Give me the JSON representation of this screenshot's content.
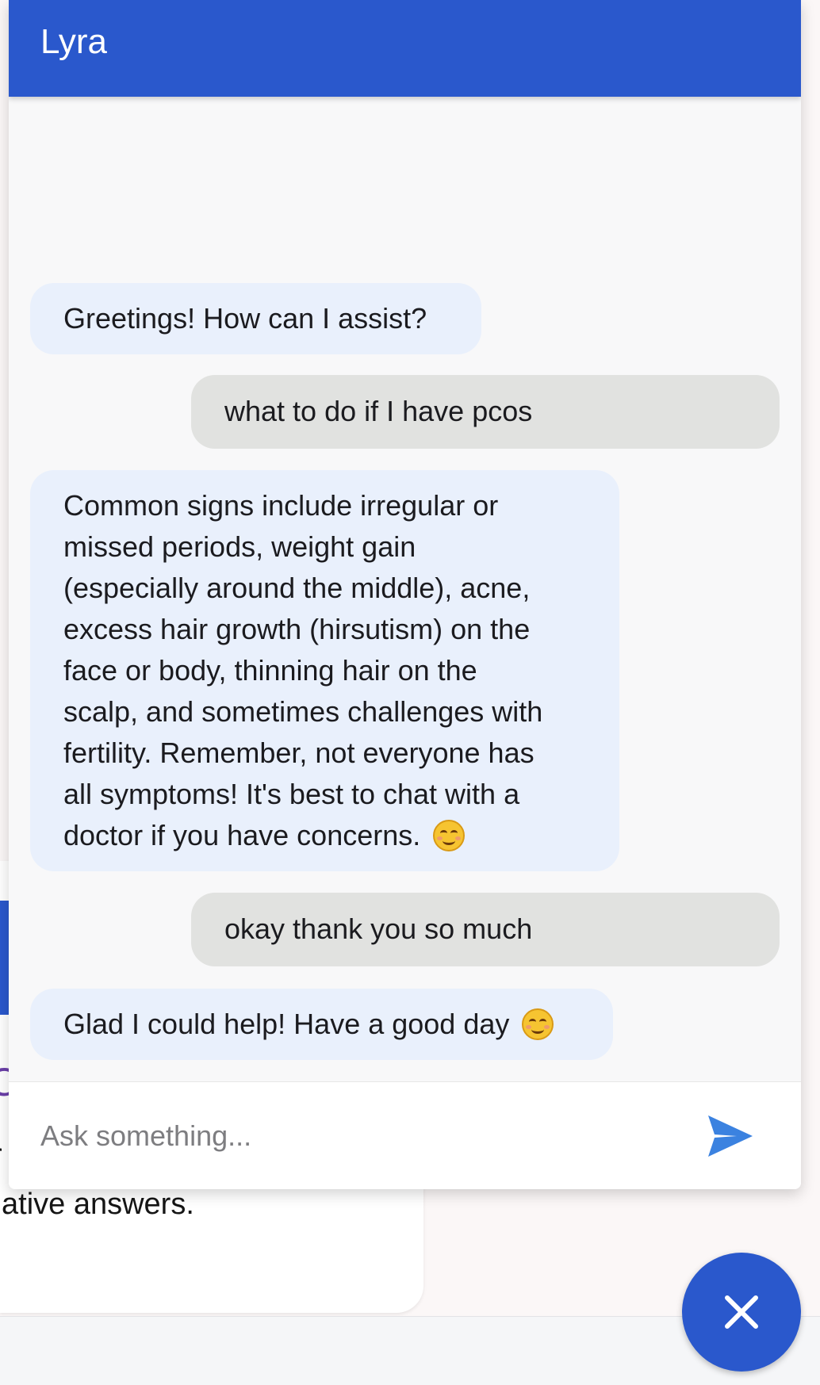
{
  "header": {
    "title": "Lyra"
  },
  "messages": [
    {
      "role": "bot",
      "text": "Greetings! How can I assist?"
    },
    {
      "role": "user",
      "text": "what to do if I have pcos"
    },
    {
      "role": "bot",
      "lines": [
        "Common signs include irregular or",
        "missed periods, weight gain",
        "(especially around the middle), acne,",
        "excess hair growth (hirsutism) on the",
        "face or body, thinning hair on the",
        "scalp, and sometimes challenges with",
        "fertility. Remember, not everyone has",
        "all symptoms! It's best to chat with a",
        "doctor if you have concerns."
      ],
      "emoji": "smiling-face-emoji"
    },
    {
      "role": "user",
      "text": "okay thank you so much"
    },
    {
      "role": "bot",
      "text": "Glad I could help! Have a good day",
      "emoji": "smiling-face-emoji"
    }
  ],
  "composer": {
    "placeholder": "Ask something...",
    "value": "",
    "send_icon": "send-icon"
  },
  "fab": {
    "icon": "close-icon"
  },
  "background": {
    "text_fragment": "ative answers.",
    "char_1": "C",
    "char_2": "r"
  },
  "colors": {
    "accent": "#2a58cc",
    "bot_bubble": "#e9f0fc",
    "user_bubble": "#e1e2e0",
    "send_icon": "#3b82e0"
  }
}
